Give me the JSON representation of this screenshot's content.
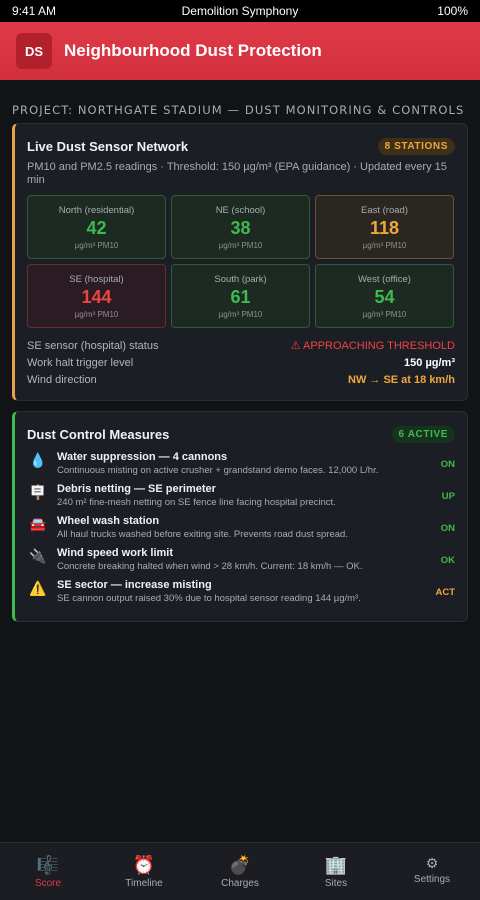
{
  "status_bar": {
    "time": "9:41 AM",
    "app_name": "Demolition Symphony",
    "battery": "100%"
  },
  "header": {
    "badge": "DS",
    "title": "Neighbourhood Dust Protection"
  },
  "project_label": "PROJECT: NORTHGATE STADIUM — DUST MONITORING & CONTROLS",
  "sensor_card": {
    "title": "Live Dust Sensor Network",
    "badge": "8 STATIONS",
    "subtitle": "PM10 and PM2.5 readings · Threshold: 150 µg/m³ (EPA guidance) · Updated every 15 min",
    "stations": [
      {
        "location": "North (residential)",
        "value": "42",
        "unit": "µg/m³ PM10",
        "status": "ok"
      },
      {
        "location": "NE (school)",
        "value": "38",
        "unit": "µg/m³ PM10",
        "status": "ok"
      },
      {
        "location": "East (road)",
        "value": "118",
        "unit": "µg/m³ PM10",
        "status": "warn"
      },
      {
        "location": "SE (hospital)",
        "value": "144",
        "unit": "µg/m³ PM10",
        "status": "alert"
      },
      {
        "location": "South (park)",
        "value": "61",
        "unit": "µg/m³ PM10",
        "status": "ok"
      },
      {
        "location": "West (office)",
        "value": "54",
        "unit": "µg/m³ PM10",
        "status": "ok"
      }
    ],
    "info": [
      {
        "label": "SE sensor (hospital) status",
        "value": "⚠ APPROACHING THRESHOLD"
      },
      {
        "label": "Work halt trigger level",
        "value": "150 µg/m³"
      },
      {
        "label": "Wind direction",
        "value": "NW → SE at 18 km/h"
      }
    ]
  },
  "measures_card": {
    "title": "Dust Control Measures",
    "badge": "6 ACTIVE",
    "items": [
      {
        "icon": "💧",
        "icon_name": "water-drop-icon",
        "title": "Water suppression — 4 cannons",
        "desc": "Continuous misting on active crusher + grandstand demo faces. 12,000 L/hr.",
        "state": "ON"
      },
      {
        "icon": "🪧",
        "icon_name": "signboard-icon",
        "title": "Debris netting — SE perimeter",
        "desc": "240 m² fine-mesh netting on SE fence line facing hospital precinct.",
        "state": "UP"
      },
      {
        "icon": "🚘",
        "icon_name": "car-icon",
        "title": "Wheel wash station",
        "desc": "All haul trucks washed before exiting site. Prevents road dust spread.",
        "state": "ON"
      },
      {
        "icon": "🔌",
        "icon_name": "plug-icon",
        "title": "Wind speed work limit",
        "desc": "Concrete breaking halted when wind > 28 km/h. Current: 18 km/h — OK.",
        "state": "OK"
      },
      {
        "icon": "⚠️",
        "icon_name": "warning-icon",
        "title": "SE sector — increase misting",
        "desc": "SE cannon output raised 30% due to hospital sensor reading 144 µg/m³.",
        "state": "ACT"
      }
    ]
  },
  "tabbar": {
    "tabs": [
      {
        "icon": "🎼",
        "label": "Score"
      },
      {
        "icon": "⏰",
        "label": "Timeline"
      },
      {
        "icon": "💣",
        "label": "Charges"
      },
      {
        "icon": "🏢",
        "label": "Sites"
      },
      {
        "icon": "⚙",
        "label": "Settings"
      }
    ]
  },
  "colors": {
    "accent_red": "#e03a48",
    "ok_green": "#3fb950",
    "warn_orange": "#f0a83e",
    "alert_red": "#ef4444"
  }
}
